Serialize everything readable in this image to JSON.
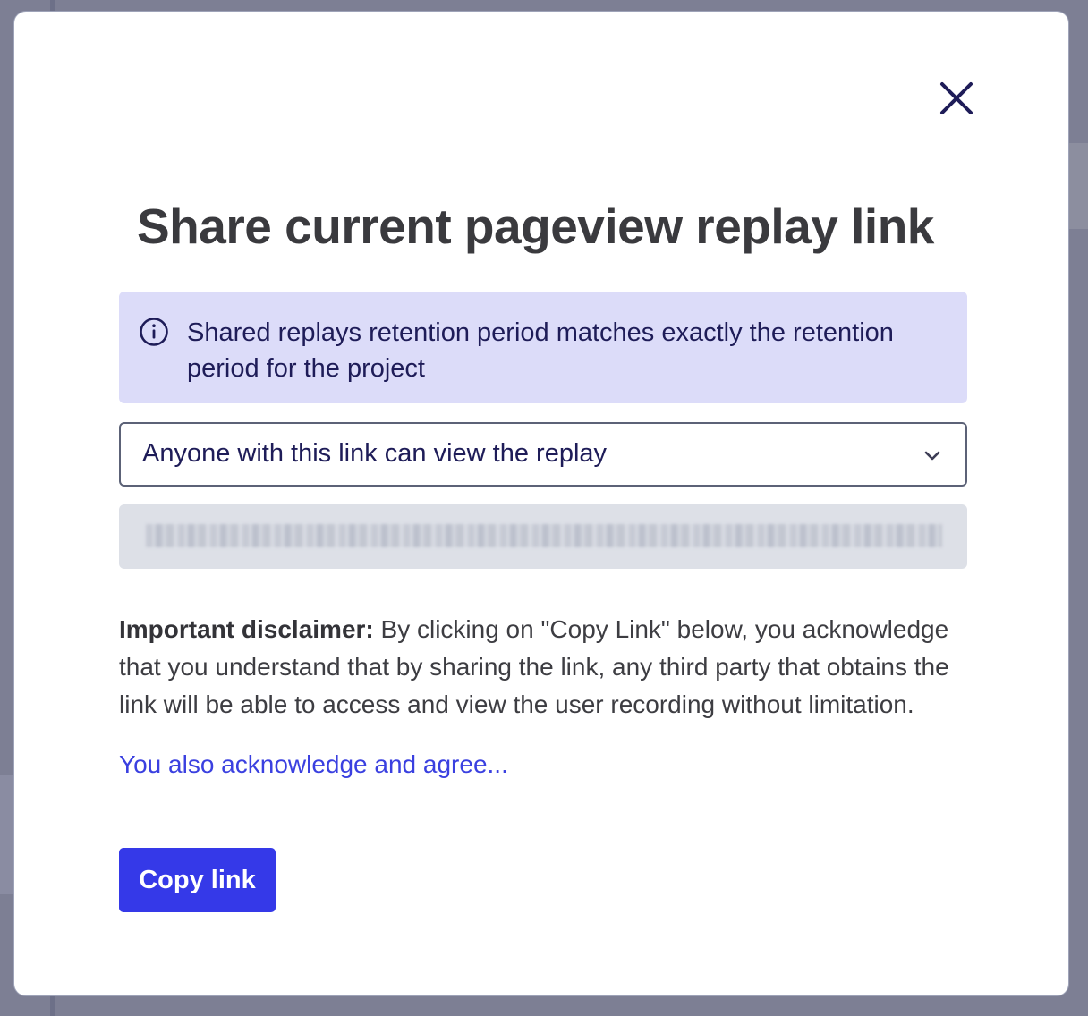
{
  "dialog": {
    "title": "Share current pageview replay link",
    "info": {
      "icon": "info-circle-icon",
      "text": "Shared replays retention period matches exactly the retention period for the project"
    },
    "access_select": {
      "selected": "Anyone with this link can view the replay",
      "icon": "chevron-down-icon"
    },
    "share_link": {
      "state": "blurred"
    },
    "disclaimer": {
      "label": "Important disclaimer:",
      "text": " By clicking on \"Copy Link\" below, you acknowledge that you understand that by sharing the link, any third party that obtains the link will be able to access and view the user recording without limitation."
    },
    "acknowledge_link": "You also acknowledge and agree...",
    "copy_button": "Copy link",
    "close_icon": "close-icon"
  },
  "colors": {
    "primary": "#3539e8",
    "info_bg": "#dcdcf9",
    "info_text": "#1e1c58",
    "link": "#3a40e0",
    "title": "#3a3a3e"
  }
}
